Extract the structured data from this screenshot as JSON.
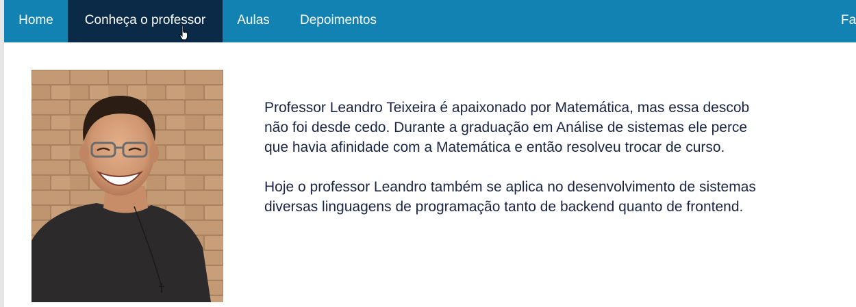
{
  "nav": {
    "items": [
      {
        "label": "Home",
        "active": false
      },
      {
        "label": "Conheça o professor",
        "active": true
      },
      {
        "label": "Aulas",
        "active": false
      },
      {
        "label": "Depoimentos",
        "active": false
      }
    ],
    "right_label": "Fa"
  },
  "colors": {
    "navbar": "#1282b2",
    "active_tab": "#0b2a48",
    "body_text": "#1a2544"
  },
  "photo": {
    "subject": "smiling-man-with-glasses-portrait"
  },
  "content": {
    "paragraph_1": "Professor Leandro Teixeira é apaixonado por Matemática, mas essa descob\nnão foi desde cedo. Durante a graduação em Análise de sistemas ele perce\nque havia afinidade com a Matemática e então resolveu trocar de curso.",
    "paragraph_2": "Hoje o professor Leandro também se aplica no desenvolvimento de sistemas\ndiversas linguagens de programação tanto de backend quanto de frontend."
  }
}
